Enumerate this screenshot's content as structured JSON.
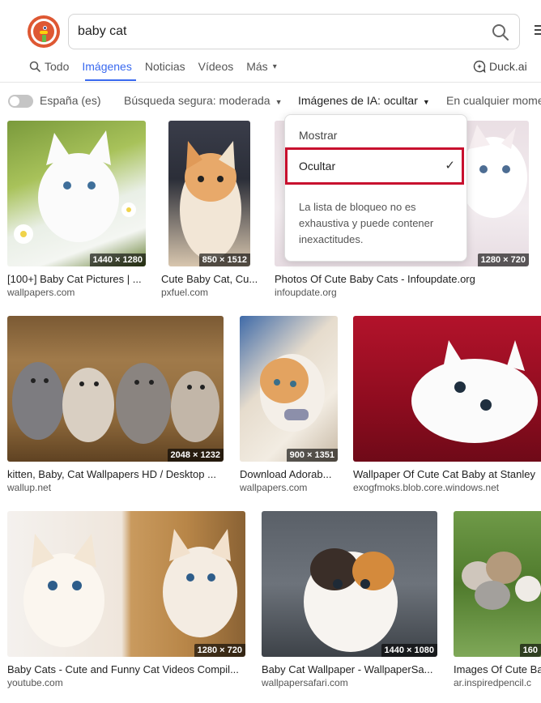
{
  "search": {
    "query": "baby cat"
  },
  "tabs": [
    {
      "label": "Todo"
    },
    {
      "label": "Imágenes"
    },
    {
      "label": "Noticias"
    },
    {
      "label": "Vídeos"
    },
    {
      "label": "Más"
    }
  ],
  "duckai": {
    "label": "Duck.ai"
  },
  "filters": {
    "region": "España (es)",
    "safe_search": "Búsqueda segura: moderada",
    "ai_images": "Imágenes de IA: ocultar",
    "time": "En cualquier momento"
  },
  "dropdown": {
    "show": "Mostrar",
    "hide": "Ocultar",
    "note": "La lista de bloqueo no es exhaustiva y puede contener inexactitudes."
  },
  "results": [
    {
      "caption": "[100+] Baby Cat Pictures | ...",
      "source": "wallpapers.com",
      "dims": "1440 × 1280"
    },
    {
      "caption": "Cute Baby Cat, Cu...",
      "source": "pxfuel.com",
      "dims": "850 × 1512"
    },
    {
      "caption": "Photos Of Cute Baby Cats - Infoupdate.org",
      "source": "infoupdate.org",
      "dims": "1280 × 720"
    },
    {
      "caption": "kitten, Baby, Cat Wallpapers HD / Desktop ...",
      "source": "wallup.net",
      "dims": "2048 × 1232"
    },
    {
      "caption": "Download Adorab...",
      "source": "wallpapers.com",
      "dims": "900 × 1351"
    },
    {
      "caption": "Wallpaper Of Cute Cat Baby at Stanley",
      "source": "exogfmoks.blob.core.windows.net",
      "dims": ""
    },
    {
      "caption": "Baby Cats - Cute and Funny Cat Videos Compil...",
      "source": "youtube.com",
      "dims": "1280 × 720"
    },
    {
      "caption": "Baby Cat Wallpaper - WallpaperSa...",
      "source": "wallpapersafari.com",
      "dims": "1440 × 1080"
    },
    {
      "caption": "Images Of Cute Ba",
      "source": "ar.inspiredpencil.c",
      "dims": "160"
    }
  ]
}
